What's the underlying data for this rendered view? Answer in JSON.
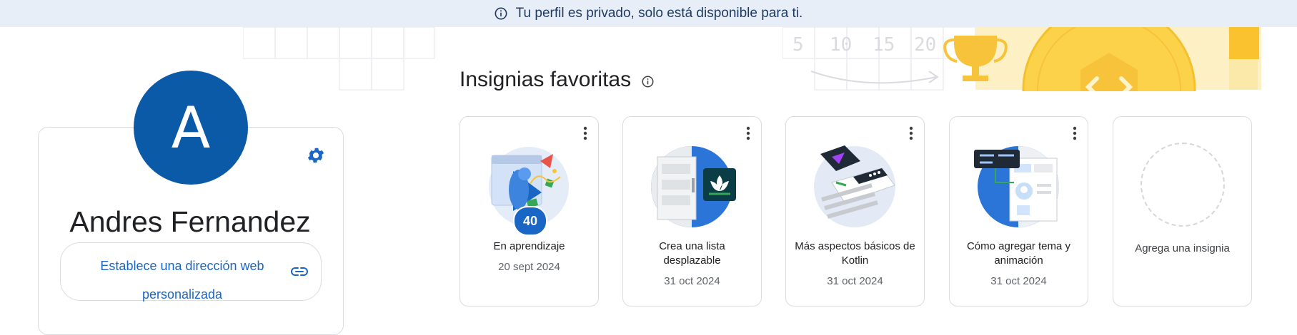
{
  "banner": {
    "text": "Tu perfil es privado, solo está disponible para ti."
  },
  "profile": {
    "avatar_letter": "A",
    "name": "Andres Fernandez",
    "url_button_label": "Establece una dirección web personalizada"
  },
  "decoration": {
    "numbers": [
      "5",
      "10",
      "15",
      "20"
    ]
  },
  "badges_section": {
    "title": "Insignias favoritas",
    "badges": [
      {
        "name": "En aprendizaje",
        "date": "20 sept 2024",
        "count": "40"
      },
      {
        "name": "Crea una lista desplazable",
        "date": "31 oct 2024"
      },
      {
        "name": "Más aspectos básicos de Kotlin",
        "date": "31 oct 2024"
      },
      {
        "name": "Cómo agregar tema y animación",
        "date": "31 oct 2024"
      }
    ],
    "add_badge_label": "Agrega una insignia"
  },
  "icons": {
    "banner": "info-icon",
    "section_title": "info-icon",
    "settings": "gear-icon",
    "url": "link-icon",
    "badge_menu": "more-vert-icon"
  },
  "colors": {
    "banner_bg": "#e8eef8",
    "avatar_bg": "#0a5aa8",
    "accent": "#1a66c4",
    "card_border": "#dadce0",
    "decor_yellow": "#fbd24a"
  }
}
